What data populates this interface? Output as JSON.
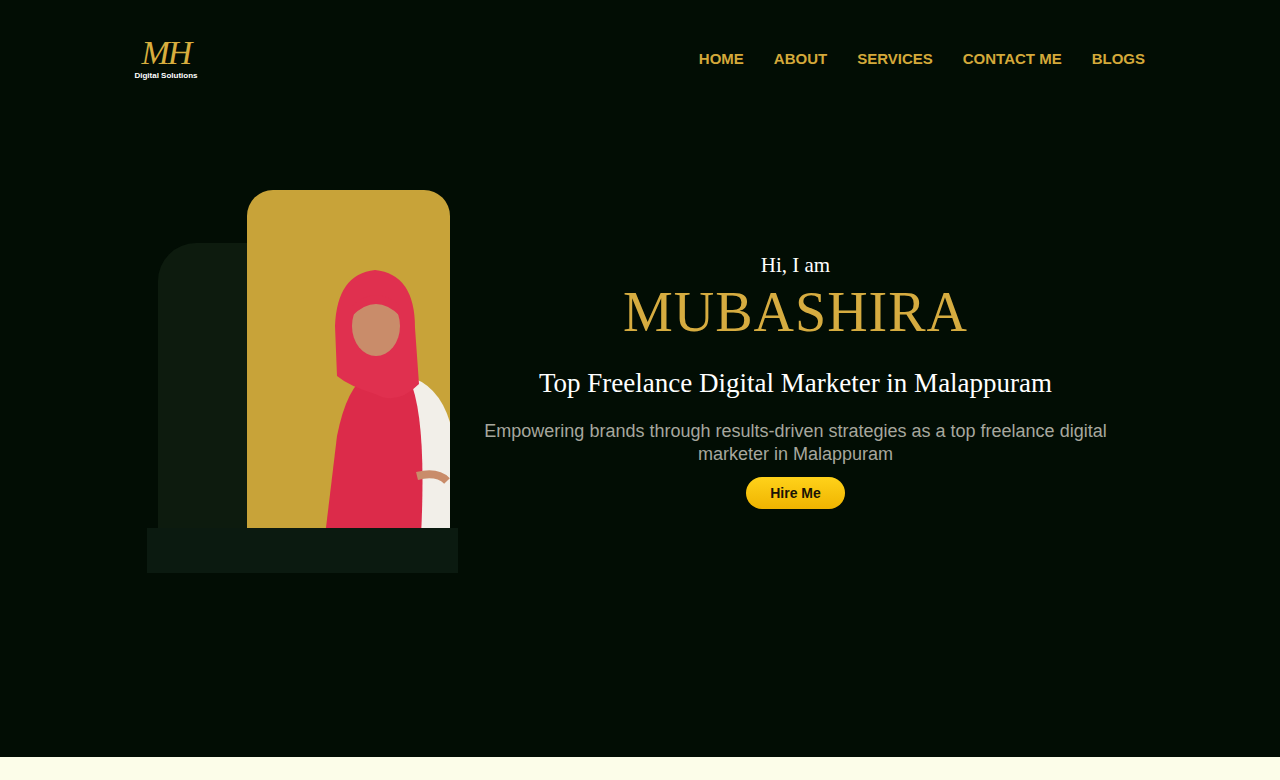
{
  "logo": {
    "mark": "MH",
    "tagline": "Digital Solutions"
  },
  "nav": [
    {
      "label": "HOME"
    },
    {
      "label": "ABOUT"
    },
    {
      "label": "SERVICES"
    },
    {
      "label": "CONTACT ME"
    },
    {
      "label": "BLOGS"
    }
  ],
  "hero": {
    "greeting": "Hi, I am",
    "name": "MUBASHIRA",
    "title": "Top Freelance Digital Marketer in Malappuram",
    "description": "Empowering brands through results-driven strategies as a top freelance digital marketer in Malappuram",
    "button": "Hire Me"
  }
}
